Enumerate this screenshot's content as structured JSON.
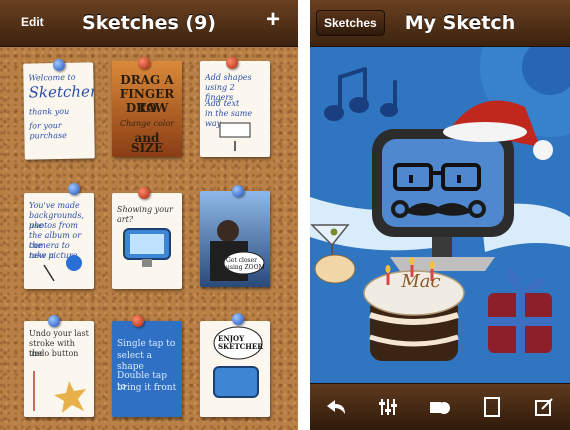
{
  "left_screen": {
    "nav": {
      "edit_label": "Edit",
      "title": "Sketches (9)",
      "add_label": "+"
    },
    "sketches": [
      {
        "lines": [
          "Welcome to",
          "Sketcher",
          "thank you",
          "for your purchase"
        ]
      },
      {
        "lines": [
          "DRAG A",
          "FINGER TO",
          "DRAW",
          "Change color",
          "and SIZE"
        ]
      },
      {
        "lines": [
          "Add shapes",
          "using 2 fingers",
          "Add text",
          "in the same way"
        ]
      },
      {
        "lines": [
          "You've made",
          "backgrounds, use",
          "photos from",
          "the album or the",
          "camera to take a",
          "new picture"
        ]
      },
      {
        "lines": [
          "Showing your art?"
        ]
      },
      {
        "lines": [
          "Get closer",
          "using ZOOM"
        ]
      },
      {
        "lines": [
          "Undo your last",
          "stroke with the",
          "undo button"
        ]
      },
      {
        "lines": [
          "Single tap to",
          "select a shape",
          "Double tap to",
          "bring it front"
        ]
      },
      {
        "lines": [
          "ENJOY",
          "SKETCHER"
        ]
      }
    ]
  },
  "right_screen": {
    "nav": {
      "back_label": "Sketches",
      "title": "My Sketch"
    },
    "cake_text": "Mac",
    "toolbar": {
      "icons": [
        "undo-icon",
        "brush-settings-icon",
        "shapes-icon",
        "page-icon",
        "export-icon"
      ]
    }
  },
  "colors": {
    "navbar": "#4a2c14",
    "cork": "#b98046",
    "canvas": "#2f75c0"
  }
}
